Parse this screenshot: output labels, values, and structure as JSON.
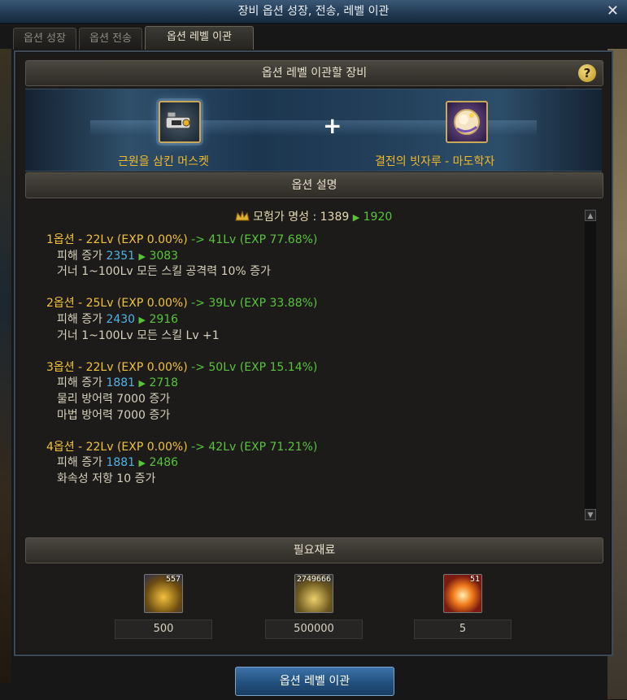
{
  "window": {
    "title": "장비 옵션 성장, 전송, 레벨 이관",
    "close_glyph": "✕"
  },
  "tabs": [
    {
      "label": "옵션 성장"
    },
    {
      "label": "옵션 전송"
    },
    {
      "label": "옵션 레벨 이관"
    }
  ],
  "equip_section": {
    "header": "옵션 레벨 이관할 장비",
    "help_label": "?",
    "plus": "+",
    "source_item": {
      "name": "근원을 삼킨 머스켓",
      "icon": "musket-icon"
    },
    "target_item": {
      "name": "결전의 빗자루 - 마도학자",
      "icon": "broom-icon"
    }
  },
  "desc_section": {
    "header": "옵션 설명",
    "summary": {
      "label": "모험가 명성 : 1389",
      "to": "1920",
      "arrow": "▶"
    },
    "options": [
      {
        "title_yellow": "1옵션 - 22Lv (EXP 0.00%)",
        "title_green": "-> 41Lv (EXP 77.68%)",
        "damage_label": "피해 증가",
        "damage_from": "2351",
        "damage_to": "3083",
        "effects": [
          "거너 1~100Lv 모든 스킬 공격력 10% 증가"
        ]
      },
      {
        "title_yellow": "2옵션 - 25Lv (EXP 0.00%)",
        "title_green": "-> 39Lv (EXP 33.88%)",
        "damage_label": "피해 증가",
        "damage_from": "2430",
        "damage_to": "2916",
        "effects": [
          "거너 1~100Lv 모든 스킬 Lv +1"
        ]
      },
      {
        "title_yellow": "3옵션 - 22Lv (EXP 0.00%)",
        "title_green": "-> 50Lv (EXP 15.14%)",
        "damage_label": "피해 증가",
        "damage_from": "1881",
        "damage_to": "2718",
        "effects": [
          "물리 방어력 7000 증가",
          "마법 방어력 7000 증가"
        ]
      },
      {
        "title_yellow": "4옵션 - 22Lv (EXP 0.00%)",
        "title_green": "-> 42Lv (EXP 71.21%)",
        "damage_label": "피해 증가",
        "damage_from": "1881",
        "damage_to": "2486",
        "effects": [
          "화속성 저항 10 증가"
        ]
      }
    ]
  },
  "materials_section": {
    "header": "필요재료",
    "materials": [
      {
        "icon": "gold-ingot-icon",
        "owned": "557",
        "required": "500"
      },
      {
        "icon": "gold-coins-icon",
        "owned": "2749666",
        "required": "500000"
      },
      {
        "icon": "fire-orb-icon",
        "owned": "51",
        "required": "5"
      }
    ]
  },
  "transfer_button": {
    "label": "옵션 레벨 이관"
  }
}
